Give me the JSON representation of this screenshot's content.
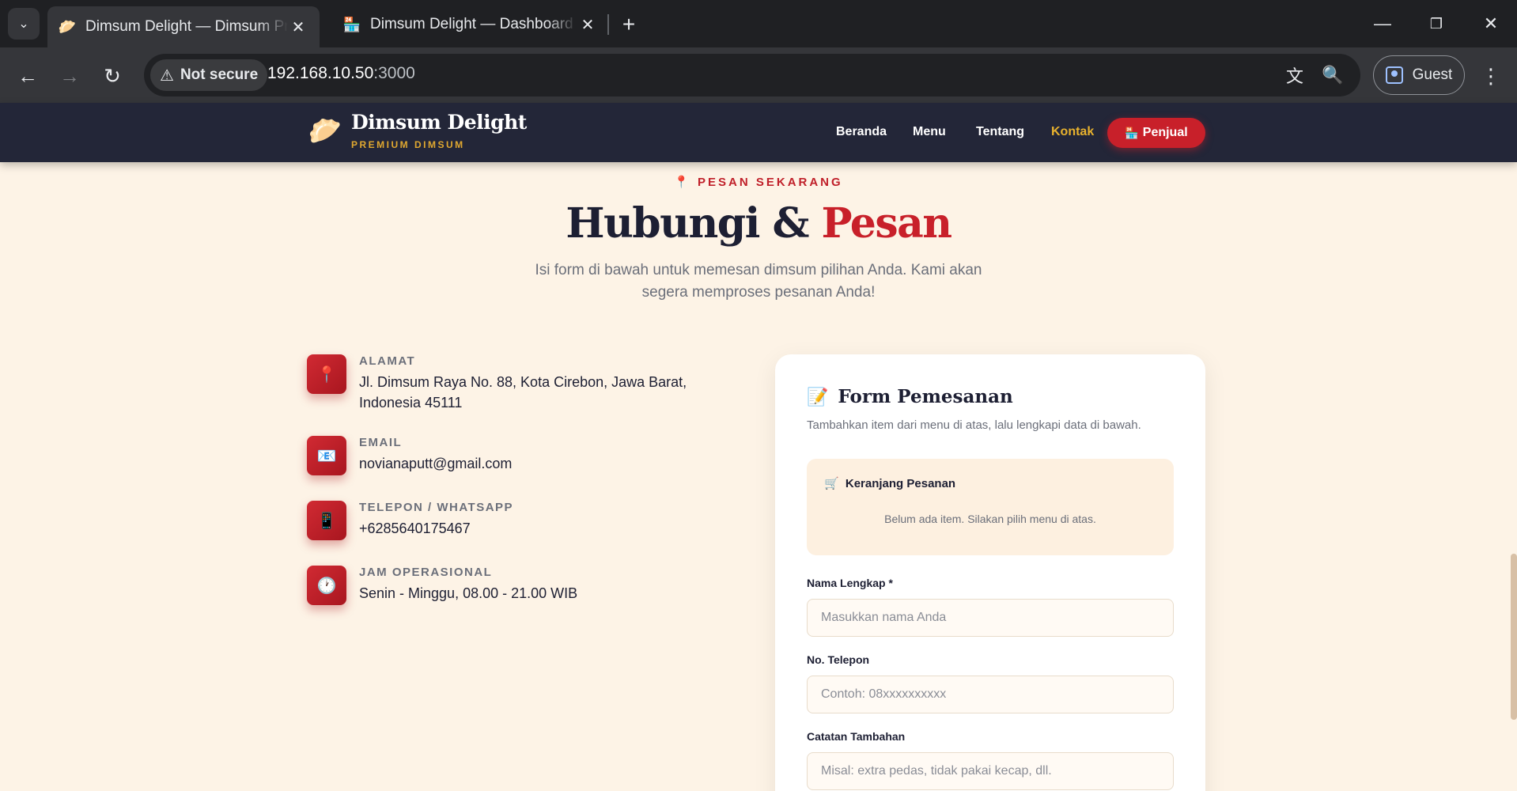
{
  "browser": {
    "tabs": [
      {
        "title": "Dimsum Delight — Dimsum Premium",
        "favicon": "🥟"
      },
      {
        "title": "Dimsum Delight — Dashboard Penjual",
        "favicon": "🏪"
      }
    ],
    "security_label": "Not secure",
    "url_host": "192.168.10.50",
    "url_port": ":3000",
    "profile_label": "Guest"
  },
  "header": {
    "logo_glyph": "🥟",
    "brand_name": "Dimsum Delight",
    "brand_tagline": "PREMIUM DIMSUM",
    "nav": [
      {
        "label": "Beranda"
      },
      {
        "label": "Menu"
      },
      {
        "label": "Tentang"
      },
      {
        "label": "Kontak",
        "active": true
      }
    ],
    "seller_button": {
      "icon": "🏪",
      "label": "Penjual"
    }
  },
  "hero": {
    "eyebrow_icon": "📍",
    "eyebrow": "PESAN SEKARANG",
    "title_main": "Hubungi & ",
    "title_accent": "Pesan",
    "subtitle": "Isi form di bawah untuk memesan dimsum pilihan Anda. Kami akan segera memproses pesanan Anda!"
  },
  "contact_info": [
    {
      "icon": "📍",
      "label": "ALAMAT",
      "value": "Jl. Dimsum Raya No. 88, Kota Cirebon, Jawa Barat, Indonesia 45111"
    },
    {
      "icon": "📧",
      "label": "EMAIL",
      "value": "novianaputt@gmail.com"
    },
    {
      "icon": "📱",
      "label": "TELEPON / WHATSAPP",
      "value": "+6285640175467"
    },
    {
      "icon": "🕐",
      "label": "JAM OPERASIONAL",
      "value": "Senin - Minggu, 08.00 - 21.00 WIB"
    }
  ],
  "form": {
    "icon": "📝",
    "title": "Form Pemesanan",
    "description": "Tambahkan item dari menu di atas, lalu lengkapi data di bawah.",
    "cart": {
      "icon": "🛒",
      "title": "Keranjang Pesanan",
      "empty_text": "Belum ada item. Silakan pilih menu di atas."
    },
    "fields": [
      {
        "label": "Nama Lengkap *",
        "placeholder": "Masukkan nama Anda",
        "value": ""
      },
      {
        "label": "No. Telepon",
        "placeholder": "Contoh: 08xxxxxxxxxx",
        "value": ""
      },
      {
        "label": "Catatan Tambahan",
        "placeholder": "Misal: extra pedas, tidak pakai kecap, dll.",
        "value": ""
      }
    ]
  },
  "colors": {
    "accent_red": "#c8202a",
    "accent_gold": "#e8b22e",
    "header_bg": "#232638",
    "page_bg": "#fdf3e6"
  }
}
